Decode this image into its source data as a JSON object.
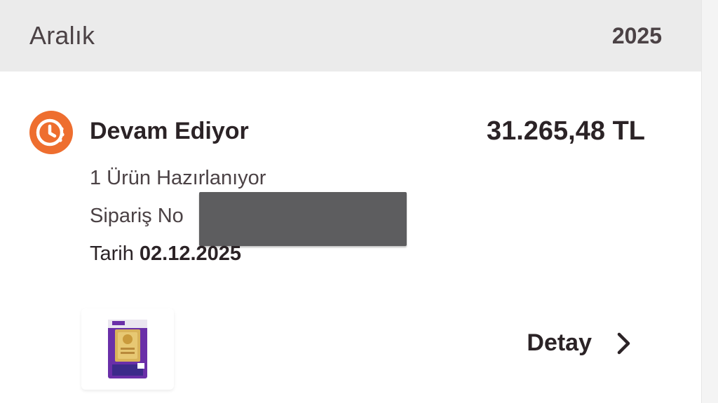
{
  "month_header": {
    "month": "Aralık",
    "year": "2025"
  },
  "order": {
    "status_label": "Devam Ediyor",
    "status_color": "#ee6e2f",
    "status_icon": "clock-icon",
    "total": "31.265,48 TL",
    "items_text": "1 Ürün Hazırlanıyor",
    "order_no_label": "Sipariş No",
    "date_label": "Tarih",
    "date_value": "02.12.2025",
    "detail_label": "Detay",
    "detail_icon": "chevron-right-icon"
  }
}
